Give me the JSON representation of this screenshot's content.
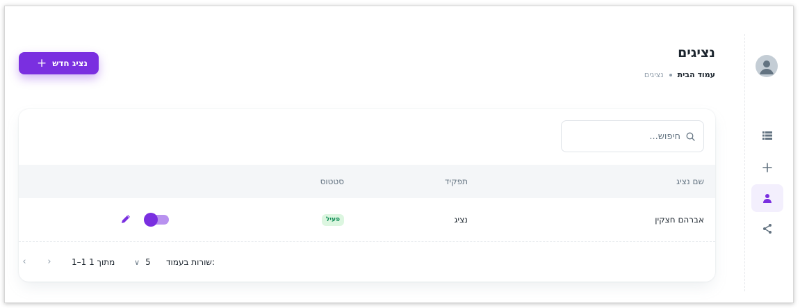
{
  "header": {
    "title": "נציגים",
    "breadcrumb_home": "עמוד הבית",
    "breadcrumb_current": "נציגים",
    "add_button_label": "נציג חדש"
  },
  "nav": {
    "avatar_icon": "user-avatar-icon",
    "items": [
      "list-icon",
      "plus-icon",
      "person-icon",
      "share-icon"
    ],
    "active_item": "person-icon"
  },
  "search": {
    "placeholder": "חיפוש...",
    "value": ""
  },
  "table": {
    "columns": [
      "שם נציג",
      "תפקיד",
      "סטטוס"
    ],
    "rows": [
      {
        "name": "אברהם חצקין",
        "role": "נציג",
        "status": "פעיל",
        "enabled": true
      }
    ]
  },
  "pagination": {
    "rows_per_page_label": "שורות בעמוד:",
    "rows_per_page_value": "5",
    "range_label": "1–1 מתוך 1"
  },
  "colors": {
    "accent": "#7a2fe0",
    "status_active_bg": "#dcf6e0",
    "status_active_text": "#118d57"
  }
}
